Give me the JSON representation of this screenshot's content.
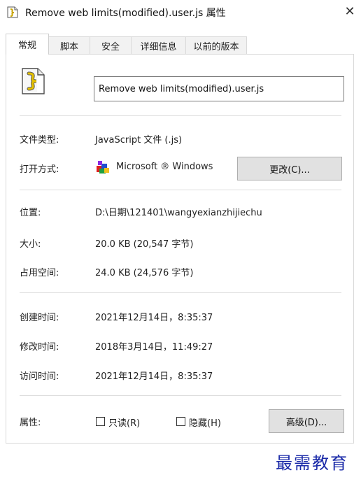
{
  "window": {
    "title": "Remove web limits(modified).user.js 属性",
    "close_label": "✕"
  },
  "tabs": [
    {
      "label": "常规",
      "active": true
    },
    {
      "label": "脚本"
    },
    {
      "label": "安全"
    },
    {
      "label": "详细信息"
    },
    {
      "label": "以前的版本"
    }
  ],
  "general": {
    "filename": "Remove web limits(modified).user.js",
    "file_type_label": "文件类型:",
    "file_type_value": "JavaScript 文件 (.js)",
    "open_with_label": "打开方式:",
    "open_with_value": "Microsoft ® Windows",
    "change_button": "更改(C)...",
    "location_label": "位置:",
    "location_value": "D:\\日期\\121401\\wangyexianzhijiechu",
    "size_label": "大小:",
    "size_value": "20.0 KB (20,547 字节)",
    "size_on_disk_label": "占用空间:",
    "size_on_disk_value": "24.0 KB (24,576 字节)",
    "created_label": "创建时间:",
    "created_value": "2021年12月14日，8:35:37",
    "modified_label": "修改时间:",
    "modified_value": "2018年3月14日，11:49:27",
    "accessed_label": "访问时间:",
    "accessed_value": "2021年12月14日，8:35:37",
    "attributes_label": "属性:",
    "readonly_label": "只读(R)",
    "readonly_checked": false,
    "hidden_label": "隐藏(H)",
    "hidden_checked": false,
    "advanced_button": "高级(D)..."
  },
  "watermark": "最需教育",
  "icons": {
    "title": "script-file-icon",
    "file": "script-file-icon",
    "open_with": "windows-script-host-icon"
  }
}
